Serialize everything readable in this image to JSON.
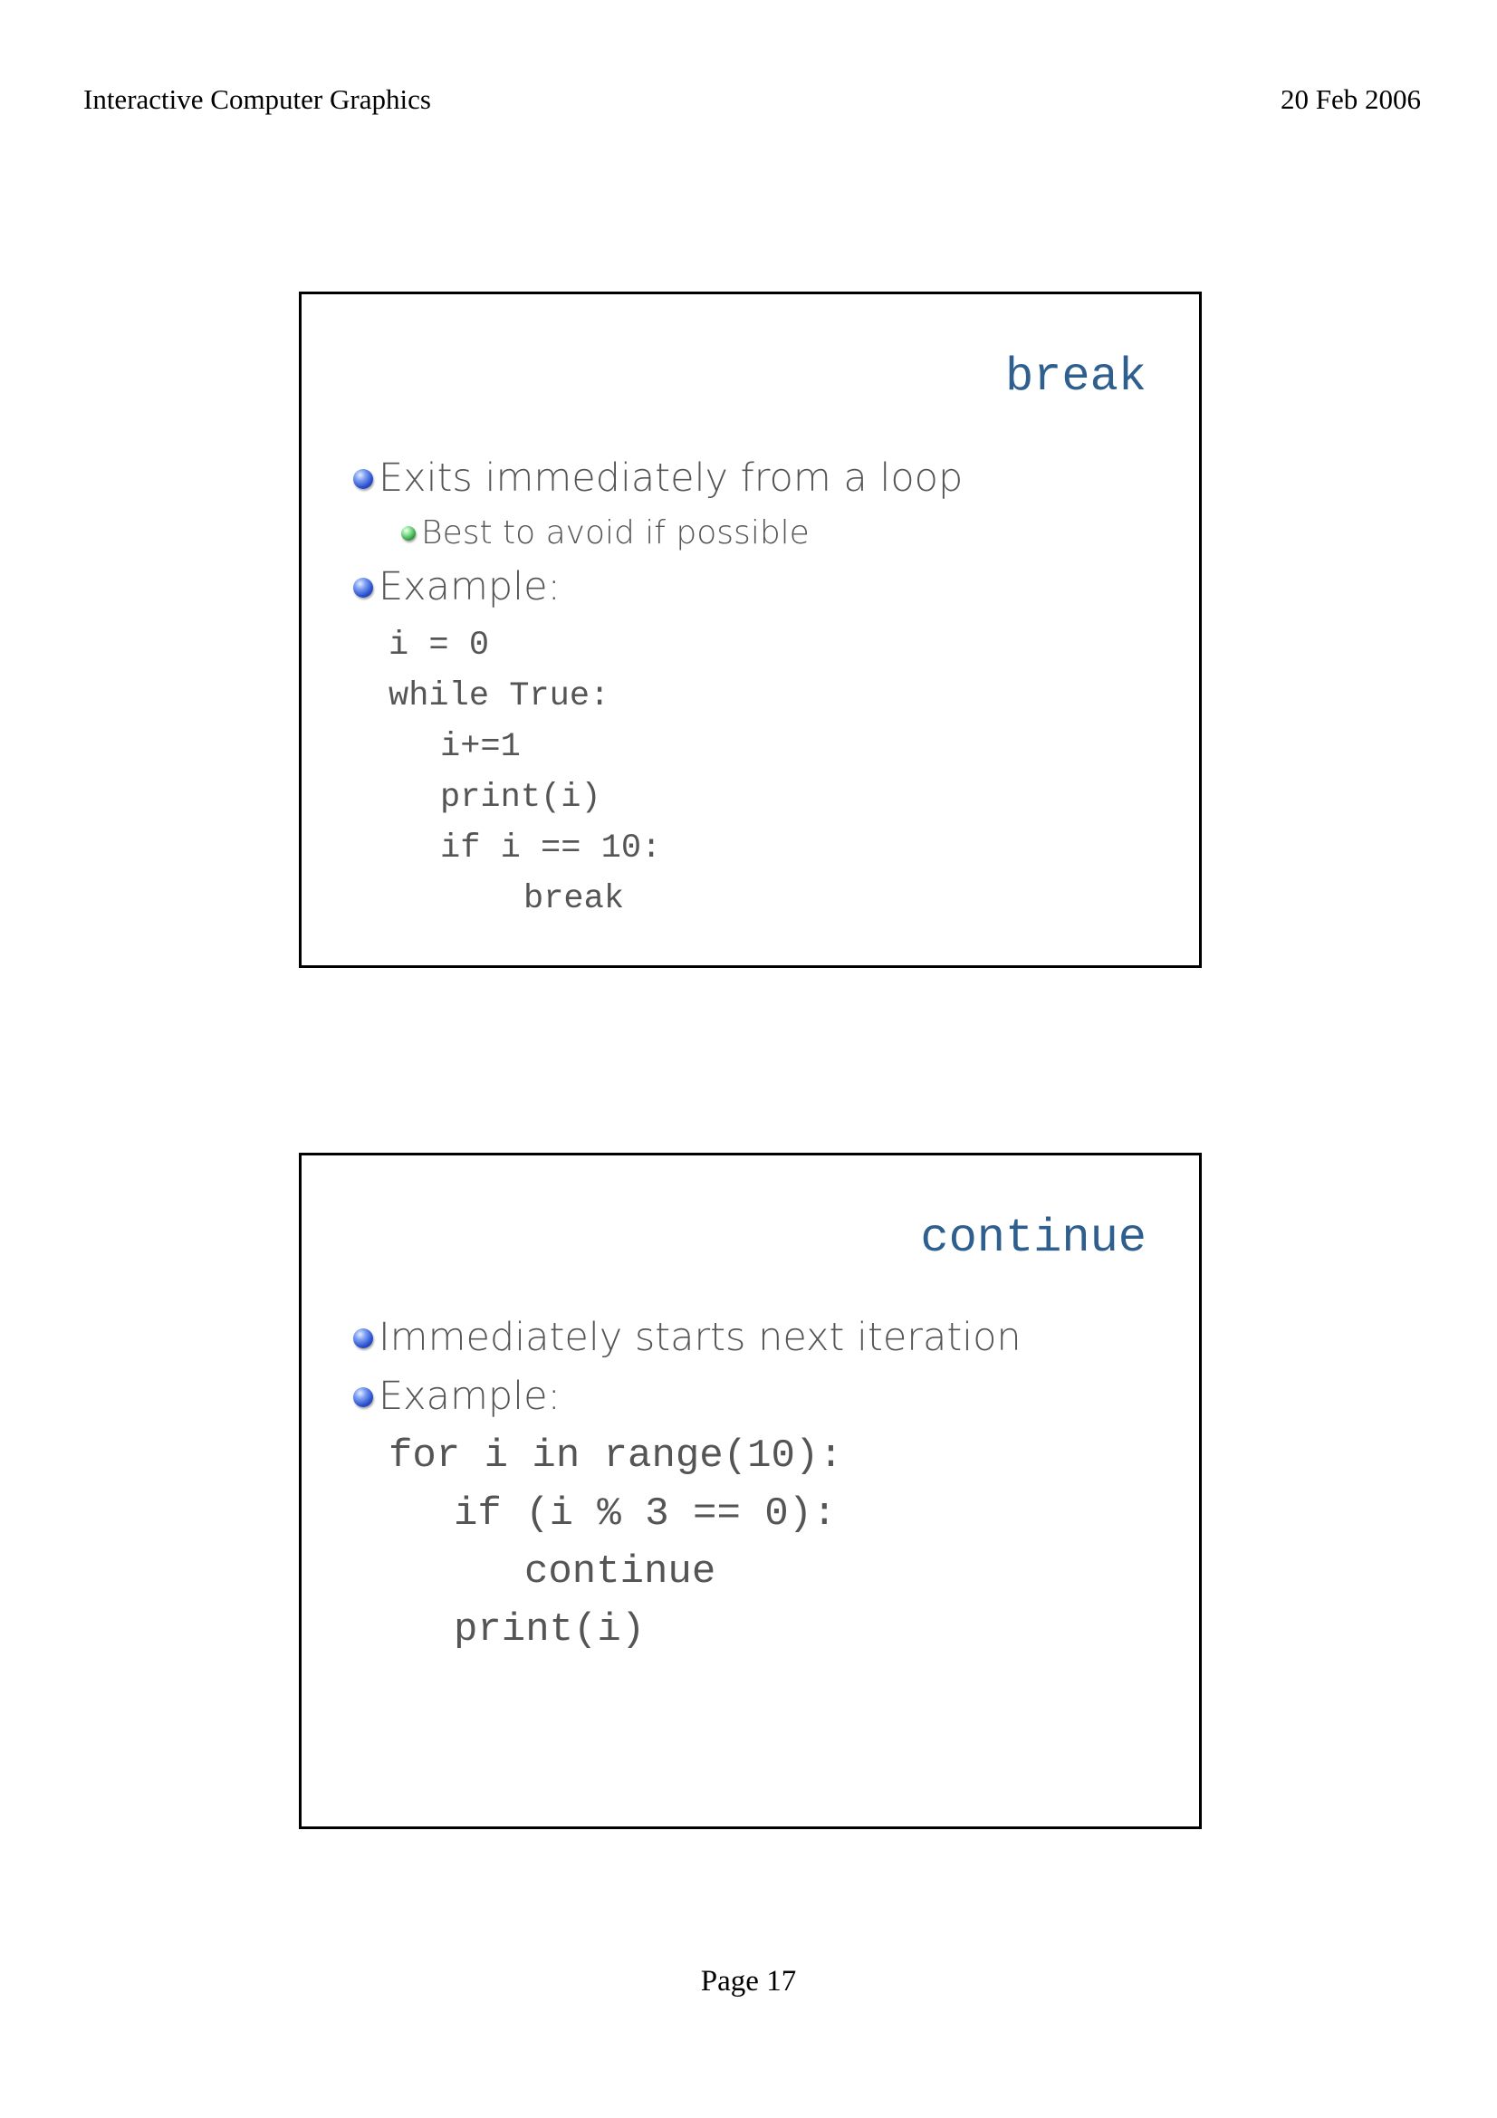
{
  "header": {
    "left": "Interactive Computer Graphics",
    "right": "20 Feb 2006"
  },
  "footer": {
    "page": "Page 17"
  },
  "slides": [
    {
      "title": "break",
      "bullets": [
        "Exits immediately from a loop",
        "Best to avoid if possible",
        "Example:"
      ],
      "code": [
        "i = 0",
        "while True:",
        "i+=1",
        "print(i)",
        "if i == 10:",
        "break"
      ]
    },
    {
      "title": "continue",
      "bullets": [
        "Immediately starts next iteration",
        "Example:"
      ],
      "code": [
        "for i in range(10):",
        "if (i % 3 == 0):",
        "continue",
        "print(i)"
      ]
    }
  ],
  "icons": {
    "bullet_primary": "blue-sphere-bullet-icon",
    "bullet_secondary": "green-sphere-bullet-icon"
  },
  "colors": {
    "title": "#2e5f8e",
    "body_text": "#555555",
    "bullet_primary": "#2a4fcf",
    "bullet_secondary": "#2f9c3d"
  }
}
